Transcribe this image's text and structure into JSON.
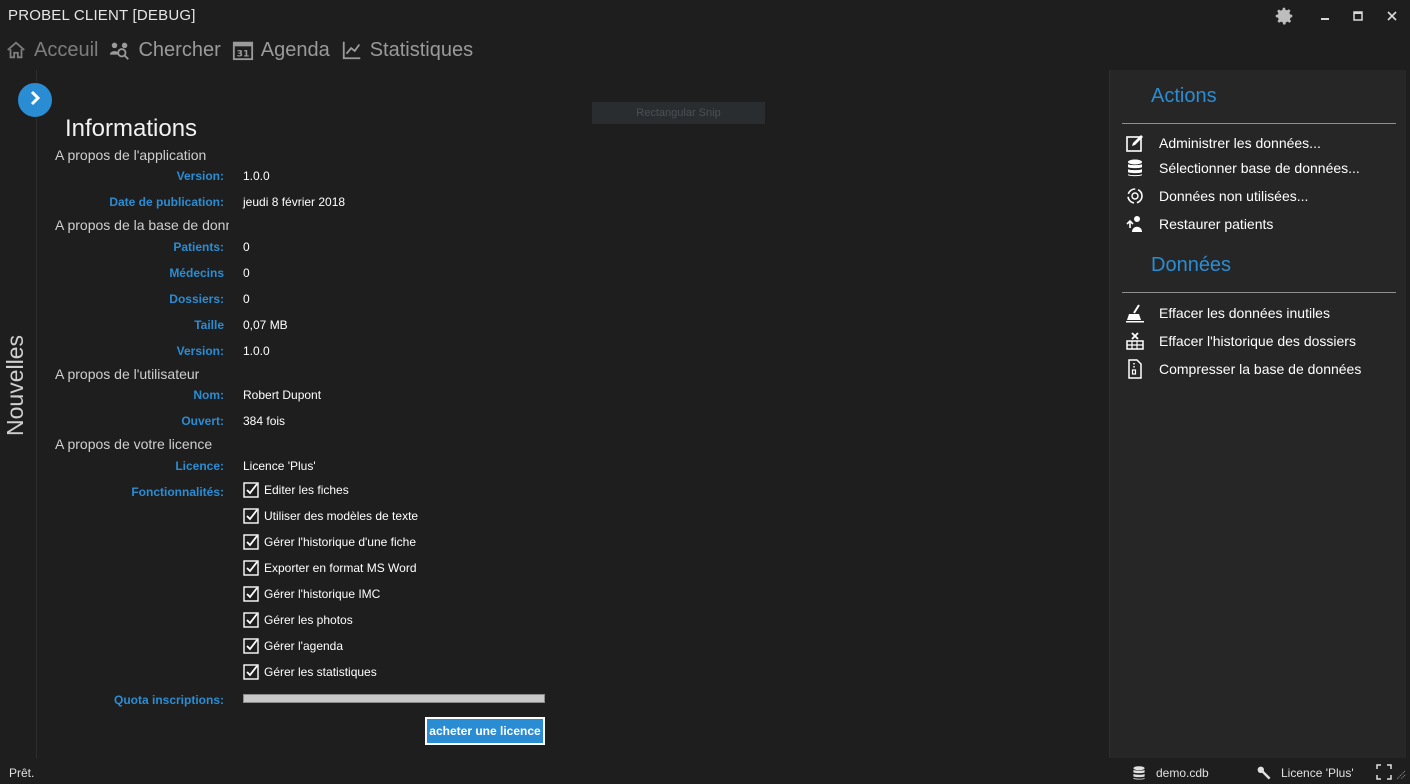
{
  "window": {
    "title": "PROBEL CLIENT [DEBUG]",
    "controls": [
      "gear-icon",
      "minimize-icon",
      "maximize-icon",
      "close-icon"
    ]
  },
  "nav": {
    "items": [
      {
        "label": "Acceuil",
        "icon": "home-icon"
      },
      {
        "label": "Chercher",
        "icon": "people-search-icon"
      },
      {
        "label": "Agenda",
        "icon": "calendar-icon"
      },
      {
        "label": "Statistiques",
        "icon": "chart-icon"
      }
    ],
    "calendar_day": "31"
  },
  "rail": {
    "label": "Nouvelles",
    "button_icon": "chevron-right-icon"
  },
  "overlay": {
    "snip_label": "Rectangular Snip"
  },
  "info": {
    "title": "Informations",
    "app": {
      "heading": "A propos de l'application",
      "version_label": "Version:",
      "version": "1.0.0",
      "date_label": "Date de publication:",
      "date": "jeudi 8 février 2018"
    },
    "db": {
      "heading": "A propos de la base de données",
      "patients_label": "Patients:",
      "patients": "0",
      "medecins_label": "Médecins",
      "medecins": "0",
      "dossiers_label": "Dossiers:",
      "dossiers": "0",
      "taille_label": "Taille",
      "taille": "0,07 MB",
      "version_label": "Version:",
      "version": "1.0.0"
    },
    "user": {
      "heading": "A propos de l'utilisateur",
      "nom_label": "Nom:",
      "nom": "Robert Dupont",
      "ouvert_label": "Ouvert:",
      "ouvert": "384 fois"
    },
    "licence": {
      "heading": "A propos de votre licence",
      "licence_label": "Licence:",
      "licence": "Licence 'Plus'",
      "features_label": "Fonctionnalités:",
      "features": [
        "Editer les fiches",
        "Utiliser des modèles de texte",
        "Gérer l'historique d'une fiche",
        "Exporter en format MS Word",
        "Gérer l'historique IMC",
        "Gérer les photos",
        "Gérer l'agenda",
        "Gérer les statistiques"
      ],
      "quota_label": "Quota inscriptions:",
      "quota_fraction": 1.0,
      "buy_label": "acheter une licence"
    }
  },
  "actions": {
    "heading": "Actions",
    "items": [
      {
        "label": "Administrer les données...",
        "icon": "edit-icon"
      },
      {
        "label": "Sélectionner base de données...",
        "icon": "database-icon"
      },
      {
        "label": "Données non utilisées...",
        "icon": "recycle-icon"
      },
      {
        "label": "Restaurer patients",
        "icon": "restore-user-icon"
      }
    ]
  },
  "donnees": {
    "heading": "Données",
    "items": [
      {
        "label": "Effacer les données inutiles",
        "icon": "broom-icon"
      },
      {
        "label": "Effacer l'historique des dossiers",
        "icon": "clear-history-icon"
      },
      {
        "label": "Compresser la base de données",
        "icon": "zip-file-icon"
      }
    ]
  },
  "status": {
    "text": "Prêt.",
    "database": "demo.cdb",
    "licence": "Licence 'Plus'"
  },
  "colors": {
    "accent": "#2a8dd4",
    "background": "#1e1e1e",
    "panel": "#262626"
  }
}
